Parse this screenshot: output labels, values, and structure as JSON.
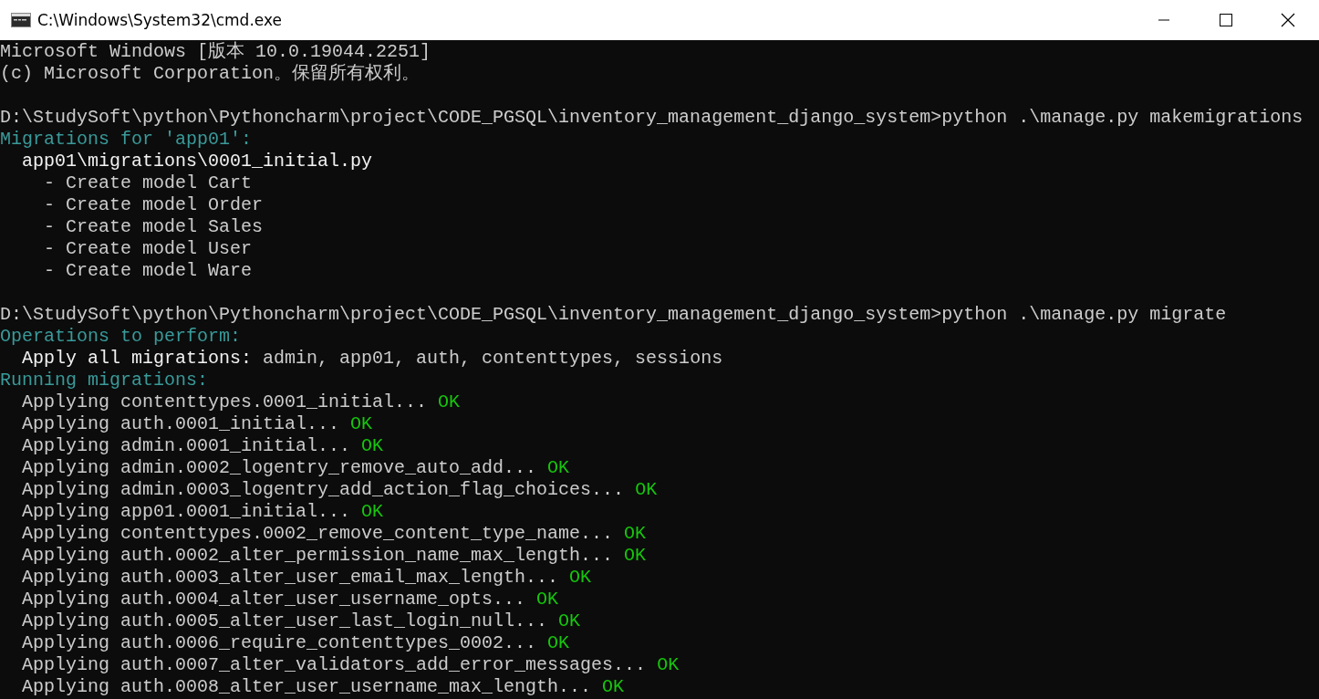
{
  "window": {
    "title": "C:\\Windows\\System32\\cmd.exe"
  },
  "console": {
    "blocks": [
      {
        "lines": [
          {
            "segments": [
              {
                "text": "Microsoft Windows [版本 10.0.19044.2251]",
                "kind": "plain"
              }
            ]
          },
          {
            "segments": [
              {
                "text": "(c) Microsoft Corporation。保留所有权利。",
                "kind": "plain"
              }
            ]
          }
        ]
      },
      {
        "lines": [
          {
            "segments": [
              {
                "text": "D:\\StudySoft\\python\\Pythoncharm\\project\\CODE_PGSQL\\inventory_management_django_system>python .\\manage.py makemigrations",
                "kind": "plain"
              }
            ]
          },
          {
            "segments": [
              {
                "text": "Migrations for 'app01':",
                "kind": "heading"
              }
            ]
          },
          {
            "segments": [
              {
                "text": "  app01\\migrations\\0001_initial.py",
                "kind": "bright"
              }
            ]
          },
          {
            "segments": [
              {
                "text": "    - Create model Cart",
                "kind": "plain"
              }
            ]
          },
          {
            "segments": [
              {
                "text": "    - Create model Order",
                "kind": "plain"
              }
            ]
          },
          {
            "segments": [
              {
                "text": "    - Create model Sales",
                "kind": "plain"
              }
            ]
          },
          {
            "segments": [
              {
                "text": "    - Create model User",
                "kind": "plain"
              }
            ]
          },
          {
            "segments": [
              {
                "text": "    - Create model Ware",
                "kind": "plain"
              }
            ]
          }
        ]
      },
      {
        "lines": [
          {
            "segments": [
              {
                "text": "D:\\StudySoft\\python\\Pythoncharm\\project\\CODE_PGSQL\\inventory_management_django_system>python .\\manage.py migrate",
                "kind": "plain"
              }
            ]
          },
          {
            "segments": [
              {
                "text": "Operations to perform:",
                "kind": "heading"
              }
            ]
          },
          {
            "segments": [
              {
                "text": "  Apply all migrations:",
                "kind": "bright"
              },
              {
                "text": " admin, app01, auth, contenttypes, sessions",
                "kind": "plain"
              }
            ]
          },
          {
            "segments": [
              {
                "text": "Running migrations:",
                "kind": "heading"
              }
            ]
          },
          {
            "segments": [
              {
                "text": "  Applying contenttypes.0001_initial...",
                "kind": "plain"
              },
              {
                "text": " OK",
                "kind": "status"
              }
            ]
          },
          {
            "segments": [
              {
                "text": "  Applying auth.0001_initial...",
                "kind": "plain"
              },
              {
                "text": " OK",
                "kind": "status"
              }
            ]
          },
          {
            "segments": [
              {
                "text": "  Applying admin.0001_initial...",
                "kind": "plain"
              },
              {
                "text": " OK",
                "kind": "status"
              }
            ]
          },
          {
            "segments": [
              {
                "text": "  Applying admin.0002_logentry_remove_auto_add...",
                "kind": "plain"
              },
              {
                "text": " OK",
                "kind": "status"
              }
            ]
          },
          {
            "segments": [
              {
                "text": "  Applying admin.0003_logentry_add_action_flag_choices...",
                "kind": "plain"
              },
              {
                "text": " OK",
                "kind": "status"
              }
            ]
          },
          {
            "segments": [
              {
                "text": "  Applying app01.0001_initial...",
                "kind": "plain"
              },
              {
                "text": " OK",
                "kind": "status"
              }
            ]
          },
          {
            "segments": [
              {
                "text": "  Applying contenttypes.0002_remove_content_type_name...",
                "kind": "plain"
              },
              {
                "text": " OK",
                "kind": "status"
              }
            ]
          },
          {
            "segments": [
              {
                "text": "  Applying auth.0002_alter_permission_name_max_length...",
                "kind": "plain"
              },
              {
                "text": " OK",
                "kind": "status"
              }
            ]
          },
          {
            "segments": [
              {
                "text": "  Applying auth.0003_alter_user_email_max_length...",
                "kind": "plain"
              },
              {
                "text": " OK",
                "kind": "status"
              }
            ]
          },
          {
            "segments": [
              {
                "text": "  Applying auth.0004_alter_user_username_opts...",
                "kind": "plain"
              },
              {
                "text": " OK",
                "kind": "status"
              }
            ]
          },
          {
            "segments": [
              {
                "text": "  Applying auth.0005_alter_user_last_login_null...",
                "kind": "plain"
              },
              {
                "text": " OK",
                "kind": "status"
              }
            ]
          },
          {
            "segments": [
              {
                "text": "  Applying auth.0006_require_contenttypes_0002...",
                "kind": "plain"
              },
              {
                "text": " OK",
                "kind": "status"
              }
            ]
          },
          {
            "segments": [
              {
                "text": "  Applying auth.0007_alter_validators_add_error_messages...",
                "kind": "plain"
              },
              {
                "text": " OK",
                "kind": "status"
              }
            ]
          },
          {
            "segments": [
              {
                "text": "  Applying auth.0008_alter_user_username_max_length...",
                "kind": "plain"
              },
              {
                "text": " OK",
                "kind": "status"
              }
            ]
          }
        ]
      }
    ]
  }
}
